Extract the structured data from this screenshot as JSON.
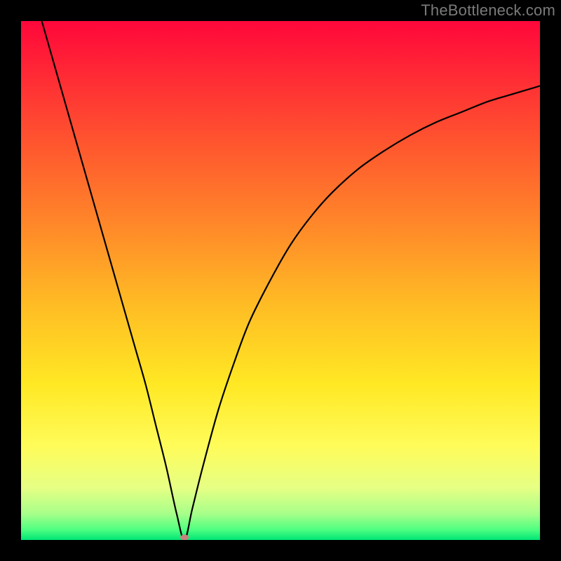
{
  "watermark": "TheBottleneck.com",
  "chart_data": {
    "type": "line",
    "title": "",
    "xlabel": "",
    "ylabel": "",
    "xlim": [
      0,
      100
    ],
    "ylim": [
      0,
      100
    ],
    "grid": false,
    "background_gradient": {
      "direction": "vertical",
      "stops": [
        {
          "pos": 0.0,
          "color": "#ff073a"
        },
        {
          "pos": 0.12,
          "color": "#ff2f34"
        },
        {
          "pos": 0.25,
          "color": "#ff5a2e"
        },
        {
          "pos": 0.4,
          "color": "#ff8a29"
        },
        {
          "pos": 0.55,
          "color": "#ffbd24"
        },
        {
          "pos": 0.7,
          "color": "#ffe824"
        },
        {
          "pos": 0.82,
          "color": "#fffc5a"
        },
        {
          "pos": 0.9,
          "color": "#e6ff84"
        },
        {
          "pos": 0.95,
          "color": "#a6ff8a"
        },
        {
          "pos": 0.98,
          "color": "#4fff81"
        },
        {
          "pos": 1.0,
          "color": "#00e676"
        }
      ]
    },
    "minimum_marker": {
      "x": 31.5,
      "y": 0.5,
      "color": "#c9817e"
    },
    "series": [
      {
        "name": "bottleneck-curve",
        "stroke": "#000000",
        "points": [
          {
            "x": 4.0,
            "y": 100.0
          },
          {
            "x": 6.0,
            "y": 93.0
          },
          {
            "x": 8.0,
            "y": 86.0
          },
          {
            "x": 10.0,
            "y": 79.0
          },
          {
            "x": 12.0,
            "y": 72.0
          },
          {
            "x": 14.0,
            "y": 65.0
          },
          {
            "x": 16.0,
            "y": 58.0
          },
          {
            "x": 18.0,
            "y": 51.0
          },
          {
            "x": 20.0,
            "y": 44.0
          },
          {
            "x": 22.0,
            "y": 37.0
          },
          {
            "x": 24.0,
            "y": 30.0
          },
          {
            "x": 26.0,
            "y": 22.0
          },
          {
            "x": 28.0,
            "y": 14.0
          },
          {
            "x": 30.0,
            "y": 5.0
          },
          {
            "x": 31.5,
            "y": 0.0
          },
          {
            "x": 33.0,
            "y": 6.0
          },
          {
            "x": 35.0,
            "y": 14.0
          },
          {
            "x": 38.0,
            "y": 25.0
          },
          {
            "x": 41.0,
            "y": 34.0
          },
          {
            "x": 44.0,
            "y": 42.0
          },
          {
            "x": 48.0,
            "y": 50.0
          },
          {
            "x": 52.0,
            "y": 57.0
          },
          {
            "x": 56.0,
            "y": 62.5
          },
          {
            "x": 60.0,
            "y": 67.0
          },
          {
            "x": 65.0,
            "y": 71.5
          },
          {
            "x": 70.0,
            "y": 75.0
          },
          {
            "x": 75.0,
            "y": 78.0
          },
          {
            "x": 80.0,
            "y": 80.5
          },
          {
            "x": 85.0,
            "y": 82.5
          },
          {
            "x": 90.0,
            "y": 84.5
          },
          {
            "x": 95.0,
            "y": 86.0
          },
          {
            "x": 100.0,
            "y": 87.5
          }
        ]
      }
    ]
  }
}
